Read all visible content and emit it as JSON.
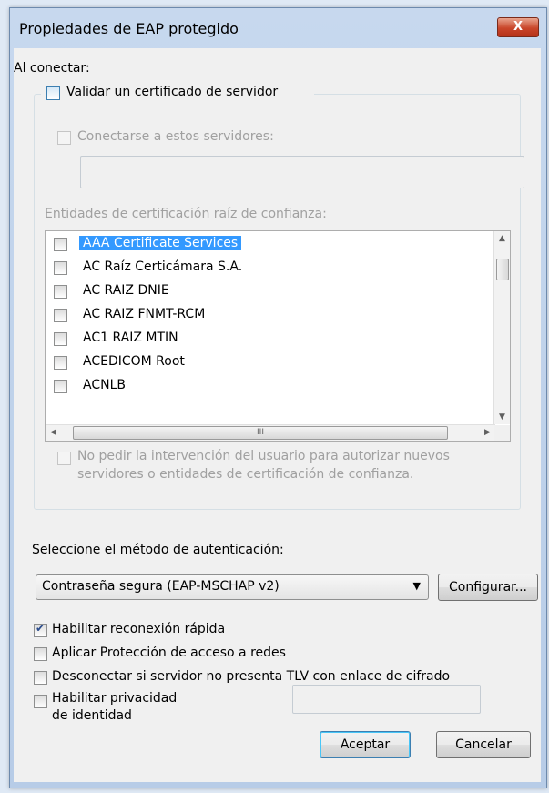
{
  "window": {
    "title": "Propiedades de EAP protegido",
    "close_label": "X"
  },
  "connect": {
    "label": "Al conectar:",
    "validate_cert": {
      "label": "Validar un certificado de servidor",
      "checked": false
    },
    "connect_servers": {
      "label": "Conectarse a estos servidores:",
      "checked": false,
      "value": ""
    },
    "trusted_roots_label": "Entidades de certificación raíz de confianza:",
    "trusted_roots": [
      {
        "label": "AAA Certificate Services",
        "checked": false,
        "selected": true
      },
      {
        "label": "AC Raíz Certicámara S.A.",
        "checked": false
      },
      {
        "label": "AC RAIZ DNIE",
        "checked": false
      },
      {
        "label": "AC RAIZ FNMT-RCM",
        "checked": false
      },
      {
        "label": "AC1 RAIZ MTIN",
        "checked": false
      },
      {
        "label": "ACEDICOM Root",
        "checked": false
      },
      {
        "label": "ACNLB",
        "checked": false
      }
    ],
    "scroll_glyphs": {
      "up": "▲",
      "down": "▼",
      "left": "◀",
      "right": "▶",
      "grip": "III"
    },
    "no_prompt": {
      "line1": "No pedir la intervención del usuario para autorizar nuevos",
      "line2": "servidores o entidades de certificación de confianza.",
      "checked": false
    }
  },
  "auth": {
    "label": "Seleccione el método de autenticación:",
    "method": "Contraseña segura (EAP-MSCHAP v2)",
    "configure_label": "Configurar..."
  },
  "options": {
    "fast_reconnect": {
      "label": "Habilitar reconexión rápida",
      "checked": true
    },
    "nap": {
      "label": "Aplicar Protección de acceso a redes",
      "checked": false
    },
    "tlv": {
      "label": "Desconectar si servidor no presenta TLV con enlace de cifrado",
      "checked": false
    },
    "identity_privacy": {
      "line1": "Habilitar privacidad",
      "line2": "de identidad",
      "checked": false,
      "value": ""
    }
  },
  "buttons": {
    "ok": "Aceptar",
    "cancel": "Cancelar"
  },
  "colors": {
    "selection": "#3399ff",
    "close_button": "#c9462a",
    "dialog_bg": "#f0f0f0"
  }
}
